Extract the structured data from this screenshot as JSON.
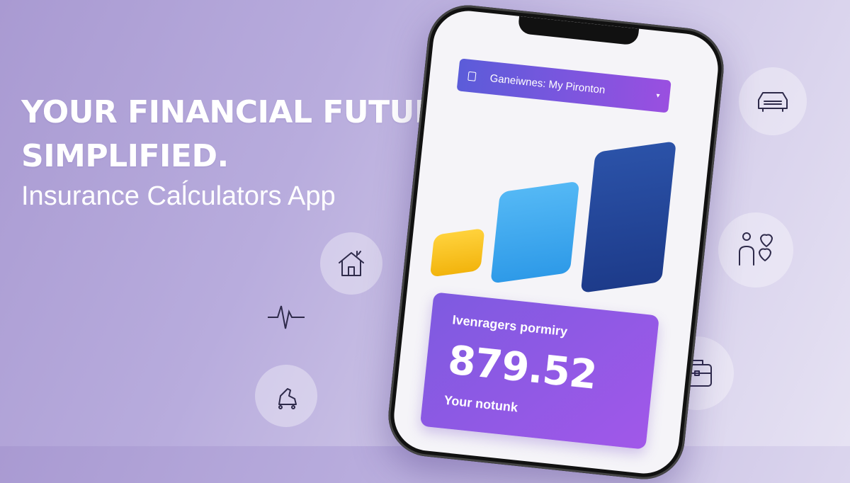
{
  "hero": {
    "headline_line1": "YOUR FINANCIAL FUTURE,",
    "headline_line2": "SIMPLIFIED.",
    "subtitle": "Insurance Caĺculators App"
  },
  "app": {
    "header_title": "Ganeiwnes: My Pironton",
    "header_chevron": "▾",
    "chart": {
      "colors": [
        "#f8c21a",
        "#3eaaf0",
        "#24489c"
      ]
    },
    "result_card": {
      "label": "Ivenragers pormiry",
      "value": "879.52",
      "sub_label": "Your notunk"
    }
  },
  "side_icons": [
    "car-icon",
    "family-heart-icon",
    "house-icon",
    "pulse-icon",
    "shoe-icon",
    "briefcase-icon"
  ],
  "colors": {
    "card_gradient_start": "#7e5ae0",
    "card_gradient_end": "#a158e9",
    "header_gradient_start": "#5b5cd9",
    "header_gradient_end": "#9a4fe0"
  }
}
